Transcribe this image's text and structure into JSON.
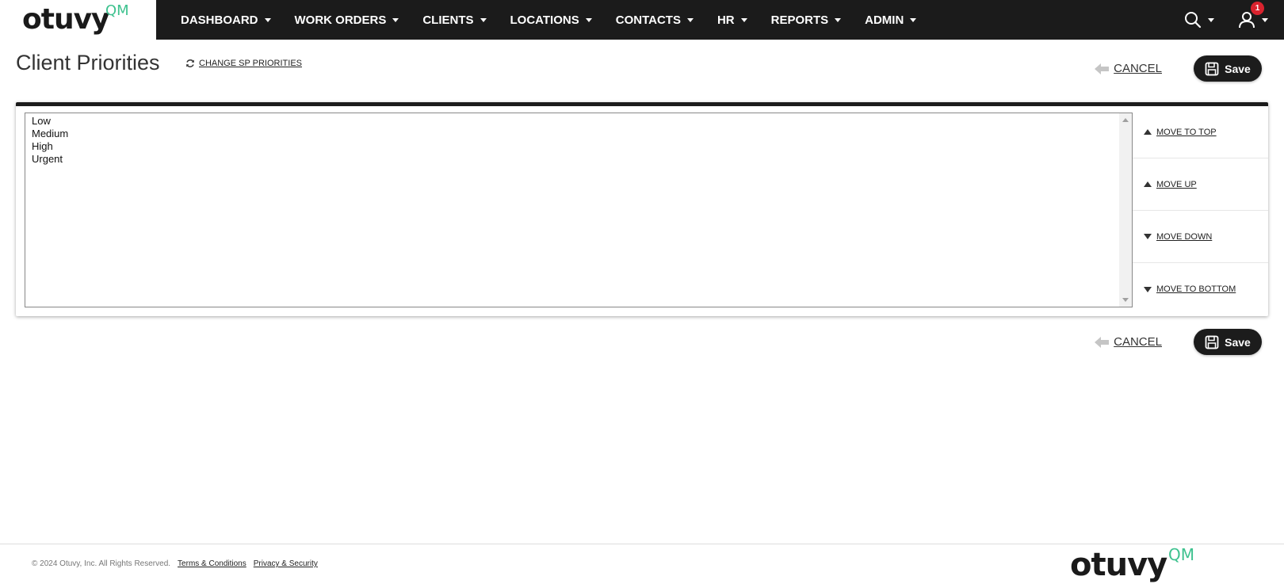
{
  "brand": {
    "name": "otuvy",
    "suffix": "QM",
    "accent": "#3ec28f"
  },
  "nav": {
    "items": [
      {
        "label": "DASHBOARD"
      },
      {
        "label": "WORK ORDERS"
      },
      {
        "label": "CLIENTS"
      },
      {
        "label": "LOCATIONS"
      },
      {
        "label": "CONTACTS"
      },
      {
        "label": "HR"
      },
      {
        "label": "REPORTS"
      },
      {
        "label": "ADMIN"
      }
    ],
    "notification_count": "1",
    "search_icon": "search-icon",
    "user_icon": "user-icon"
  },
  "page": {
    "title": "Client Priorities",
    "change_link": "CHANGE SP PRIORITIES"
  },
  "actions": {
    "cancel": "CANCEL",
    "save": "Save"
  },
  "priorities": [
    "Low",
    "Medium",
    "High",
    "Urgent"
  ],
  "move": {
    "top": "MOVE TO TOP",
    "up": "MOVE UP",
    "down": "MOVE DOWN",
    "bottom": "MOVE TO BOTTOM"
  },
  "footer": {
    "copyright": "© 2024 Otuvy, Inc. All Rights Reserved.",
    "terms": "Terms & Conditions",
    "privacy": "Privacy & Security"
  }
}
